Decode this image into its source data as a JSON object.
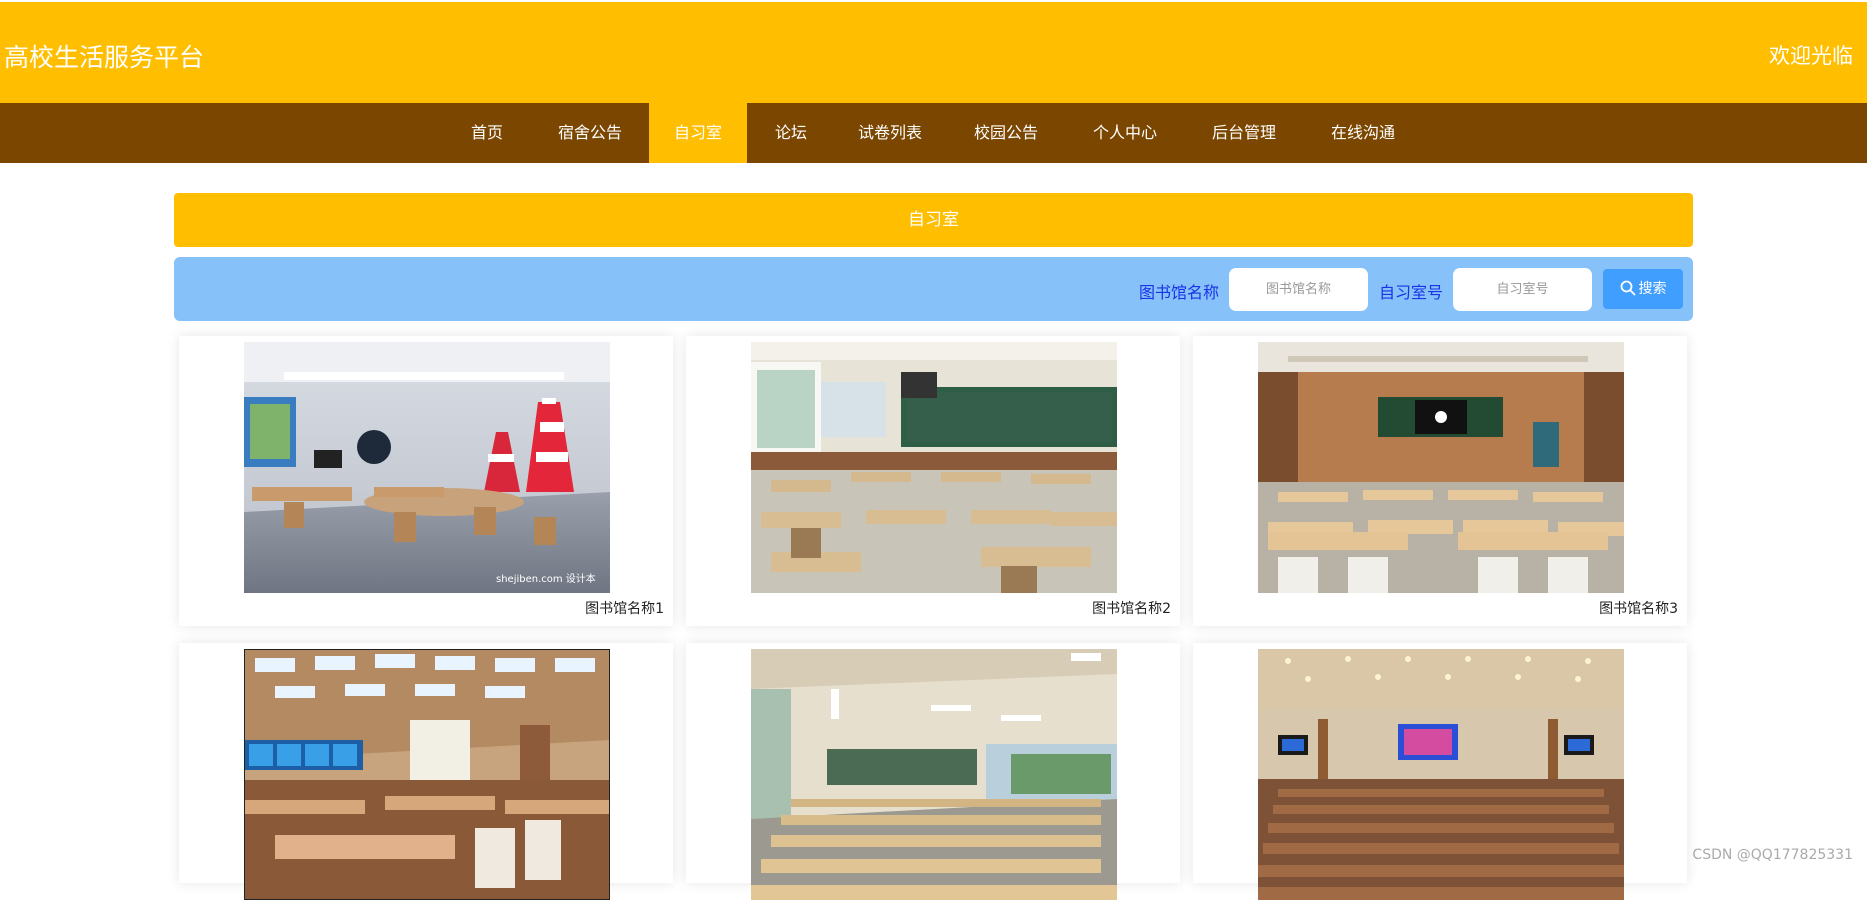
{
  "header": {
    "title": "高校生活服务平台",
    "welcome": "欢迎光临"
  },
  "nav": {
    "items": [
      "首页",
      "宿舍公告",
      "自习室",
      "论坛",
      "试卷列表",
      "校园公告",
      "个人中心",
      "后台管理",
      "在线沟通"
    ],
    "active_index": 2
  },
  "section": {
    "title": "自习室"
  },
  "search": {
    "library_label": "图书馆名称",
    "library_placeholder": "图书馆名称",
    "room_label": "自习室号",
    "room_placeholder": "自习室号",
    "button_label": "搜索"
  },
  "rooms": [
    {
      "caption": "图书馆名称1"
    },
    {
      "caption": "图书馆名称2"
    },
    {
      "caption": "图书馆名称3"
    },
    {
      "caption": ""
    },
    {
      "caption": ""
    },
    {
      "caption": ""
    }
  ],
  "image_marks": {
    "room1": "shejiben.com 设计本"
  },
  "watermark": "CSDN @QQ177825331",
  "colors": {
    "primary": "#FFBF00",
    "nav_bg": "#7A4600",
    "search_bg": "#86C1F9",
    "button": "#409EFF",
    "label": "#1833E8"
  }
}
